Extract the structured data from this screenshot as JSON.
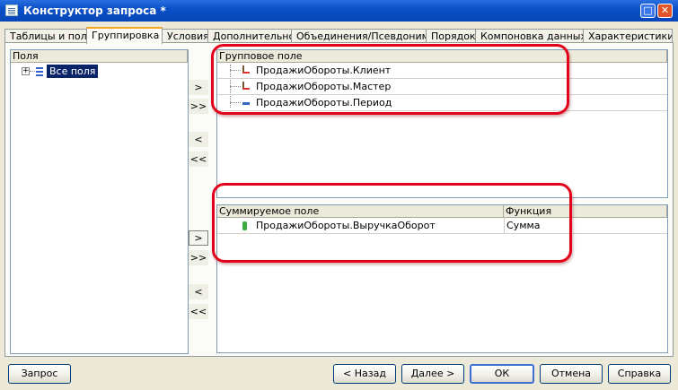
{
  "window": {
    "title": "Конструктор запроса *"
  },
  "tabs": [
    {
      "label": "Таблицы и поля"
    },
    {
      "label": "Группировка"
    },
    {
      "label": "Условия"
    },
    {
      "label": "Дополнительно"
    },
    {
      "label": "Объединения/Псевдонимы"
    },
    {
      "label": "Порядок"
    },
    {
      "label": "Компоновка данных"
    },
    {
      "label": "Характеристики"
    }
  ],
  "fields_panel": {
    "header": "Поля",
    "root_item": "Все поля"
  },
  "group_fields": {
    "header": "Групповое поле",
    "items": [
      "ПродажиОбороты.Клиент",
      "ПродажиОбороты.Мастер",
      "ПродажиОбороты.Период"
    ]
  },
  "sum_fields": {
    "header_field": "Суммируемое поле",
    "header_function": "Функция",
    "rows": [
      {
        "field": "ПродажиОбороты.ВыручкаОборот",
        "function": "Сумма"
      }
    ]
  },
  "move_buttons": {
    "add": ">",
    "add_all": ">>",
    "remove": "<",
    "remove_all": "<<"
  },
  "footer": {
    "query": "Запрос",
    "back": "< Назад",
    "next": "Далее >",
    "ok": "ОК",
    "cancel": "Отмена",
    "help": "Справка"
  },
  "colors": {
    "highlight": "#e3001b",
    "selection": "#0a246a"
  }
}
